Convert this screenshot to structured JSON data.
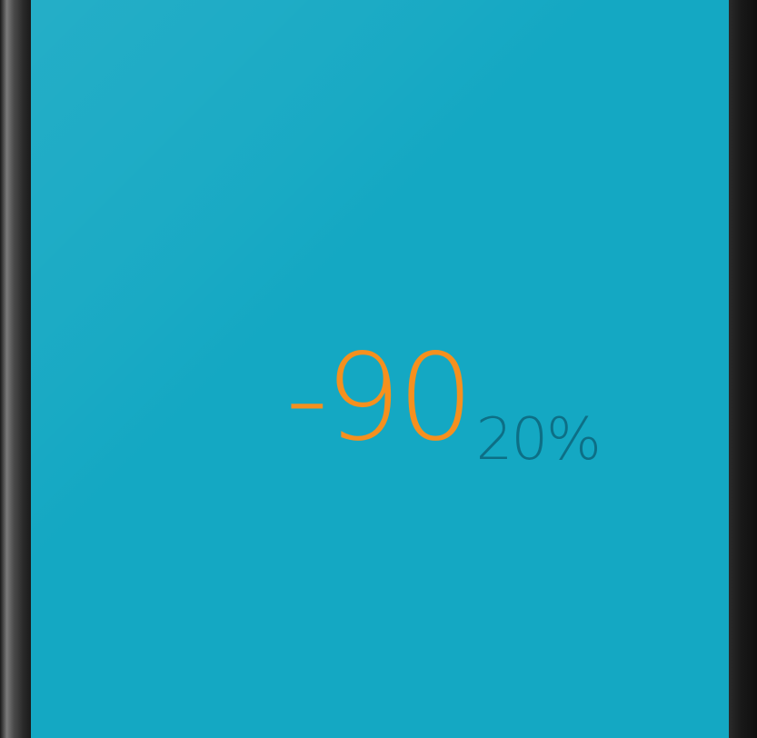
{
  "readout": {
    "main_value": "-90",
    "sub_value": "20%"
  },
  "colors": {
    "screen_background": "#14a8c3",
    "main_value_color": "#f5901e",
    "sub_value_color": "#0d6f86"
  }
}
